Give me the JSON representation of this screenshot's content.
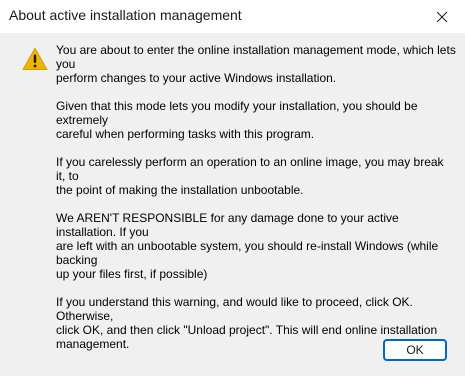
{
  "window": {
    "title": "About active installation management"
  },
  "icons": {
    "close": "close-icon",
    "warning": "warning-icon"
  },
  "colors": {
    "warning_fill": "#f0b400",
    "accent": "#0067c0"
  },
  "message": {
    "paragraphs": [
      "You are about to enter the online installation management mode, which lets you\nperform changes to your active Windows installation.",
      "Given that this mode lets you modify your installation, you should be extremely\ncareful when performing tasks with this program.",
      "If you carelessly perform an operation to an online image, you may break it, to\nthe point of making the installation unbootable.",
      "We AREN'T RESPONSIBLE for any damage done to your active installation. If you\nare left with an unbootable system, you should re-install Windows (while backing\nup your files first, if possible)",
      "If you understand this warning, and would like to proceed, click OK. Otherwise,\nclick OK, and then click \"Unload project\". This will end online installation\nmanagement."
    ]
  },
  "buttons": {
    "ok_label": "OK"
  }
}
